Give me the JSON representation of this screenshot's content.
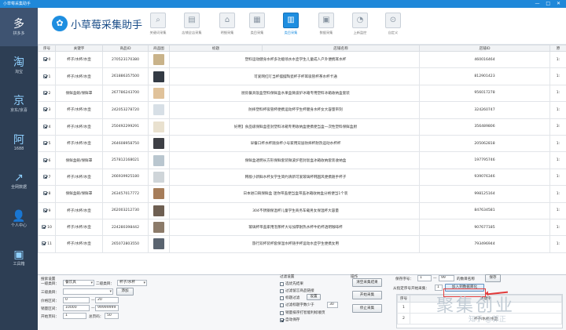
{
  "titlebar": {
    "title": "小草莓采集助手",
    "controls": "—  □  ✕"
  },
  "sidebar": {
    "items": [
      {
        "label": "拼多多",
        "icon": "pdd-icon",
        "glyph": "多"
      },
      {
        "label": "淘宝",
        "icon": "taobao-icon",
        "glyph": "淘"
      },
      {
        "label": "京东/京喜",
        "icon": "jd-icon",
        "glyph": "京"
      },
      {
        "label": "1688",
        "icon": "alibaba-icon",
        "glyph": "阿"
      },
      {
        "label": "全网数据",
        "icon": "chart-icon",
        "glyph": "↗"
      },
      {
        "label": "个人中心",
        "icon": "user-icon",
        "glyph": "👤"
      },
      {
        "label": "工具箱",
        "icon": "toolbox-icon",
        "glyph": "▣"
      }
    ]
  },
  "header": {
    "app_name": "小草莓采集助手",
    "logo_glyph": "✿"
  },
  "toolbar": {
    "tools": [
      {
        "label": "关键词采集",
        "glyph": "⌕",
        "active": false
      },
      {
        "label": "店铺全店采集",
        "glyph": "▤",
        "active": false
      },
      {
        "label": "明细采集",
        "glyph": "⌂",
        "active": false
      },
      {
        "label": "类目采集",
        "glyph": "▦",
        "active": false
      },
      {
        "label": "类目采集",
        "glyph": "▥",
        "active": true
      },
      {
        "label": "数据采集",
        "glyph": "▣",
        "active": false
      },
      {
        "label": "上新监控",
        "glyph": "◔",
        "active": false
      },
      {
        "label": "自定义",
        "glyph": "⊙",
        "active": false
      }
    ]
  },
  "table": {
    "headers": [
      "序号",
      "关键字",
      "商品ID",
      "商品图",
      "标题",
      "店铺名称",
      "店铺ID",
      "原"
    ],
    "rows": [
      {
        "seq": "0",
        "kw": "杯子/水杯/水壶",
        "id": "270523170380",
        "title": "塑料运动健身水杯多功能喷水水壶学生儿童成人户外便携耳水杯",
        "shop": "",
        "shopid": "460016464",
        "extra": "1:",
        "thumb": "#c9b38a"
      },
      {
        "seq": "1",
        "kw": "杯子/水杯/水壶",
        "id": "261886357500",
        "title": "可爱网红叮当杯摆摆陶瓷杯子杯耳吸管杯茶水杯卡通",
        "shop": "",
        "shopid": "812901423",
        "extra": "1:",
        "thumb": "#333a44"
      },
      {
        "seq": "2",
        "kw": "保鲜盒碗/保鲜罩",
        "id": "267786243700",
        "title": "厨房餐具饭盒塑料保鲜盒水果盒微波炉冰箱专用塑料冰箱收纳盒套装",
        "shop": "",
        "shopid": "956017278",
        "extra": "1:",
        "thumb": "#e0c29a"
      },
      {
        "seq": "3",
        "kw": "杯子/水杯/水壶",
        "id": "242053278720",
        "title": "防摔塑料杯吸管杯便携运动杯学生杯健身水杯女大容量带刻",
        "shop": "",
        "shopid": "324260747",
        "extra": "1:",
        "thumb": "#d7dfe6"
      },
      {
        "seq": "4",
        "kw": "杯子/水杯/水壶",
        "id": "250492299291",
        "title": "好用】食品级保鲜盒密封塑料冰箱专用收纳盒便携便当盒一次性塑料保鲜盒厨",
        "shop": "",
        "shopid": "356489806",
        "extra": "3:",
        "thumb": "#e9e1cf"
      },
      {
        "seq": "5",
        "kw": "杯子/水杯/水壶",
        "id": "264608958750",
        "title": "早餐口杯水杯随身杯小号家用双层防摔杯耐热运动水杯杯",
        "shop": "",
        "shopid": "205062818",
        "extra": "1:",
        "thumb": "#3d3f45"
      },
      {
        "seq": "6",
        "kw": "保鲜盒碗/保鲜罩",
        "id": "257812168021",
        "title": "保鲜盒透明长方形保鲜套装微波炉密封饭盒冰箱收纳套装收纳盒",
        "shop": "",
        "shopid": "197795746",
        "extra": "1:",
        "thumb": "#b9c6cf"
      },
      {
        "seq": "7",
        "kw": "杯子/水杯/水壶",
        "id": "266939925180",
        "title": "韩版小新鲜水杯女学生简约清新可爱玻璃杯韩国风便携随手杯子",
        "shop": "",
        "shopid": "939076346",
        "extra": "1:",
        "thumb": "#cfd5d9"
      },
      {
        "seq": "8",
        "kw": "保鲜盒碗/保鲜罩",
        "id": "263457017772",
        "title": "日本进口碗保鲜盒 迷你带盖便当盒带盖冰箱收纳盒分格便当1个装",
        "shop": "",
        "shopid": "998125164",
        "extra": "1:",
        "thumb": "#a67d5a"
      },
      {
        "seq": "9",
        "kw": "杯子/水杯/水壶",
        "id": "262003212730",
        "title": "304不锈钢保温杯儿童学生商务车载男女保温杯大容量",
        "shop": "",
        "shopid": "847634581",
        "extra": "1:",
        "thumb": "#6e5f52"
      },
      {
        "seq": "10",
        "kw": "杯子/水杯/水壶",
        "id": "224280398442",
        "title": "玻璃杯带盖家用泡茶杯大号加厚耐热水杯牛奶杯透明咖啡杯",
        "shop": "",
        "shopid": "907677185",
        "extra": "1:",
        "thumb": "#8c7b6a"
      },
      {
        "seq": "11",
        "kw": "杯子/水杯/水壶",
        "id": "265072803550",
        "title": "旅行双杯装杯套保温水杯随手杯运动水壶学生便携女用",
        "shop": "",
        "shopid": "793496944",
        "extra": "1:",
        "thumb": "#5a6470"
      }
    ]
  },
  "search": {
    "title": "搜索设置",
    "l1": "一级类目：",
    "v1": "餐饮具",
    "l2": "二级类目：",
    "v2": "杯子/水杯",
    "l3": "三级类目：",
    "add": "添加",
    "price_l": "价格区间：",
    "p_from": "0",
    "p_to": "20",
    "sales_l": "销量区间：",
    "s_from": "10000",
    "s_to": "99999999",
    "page_l": "开始页码：",
    "page": "1",
    "per_l": "总页码：",
    "per": "50",
    "dash": "—"
  },
  "filter": {
    "title": "过滤设置",
    "items": [
      {
        "label": "选优先结果",
        "on": false
      },
      {
        "label": "过滤留言商品链接",
        "on": false
      },
      {
        "label": "标题过滤",
        "on": false,
        "btn": "设置"
      },
      {
        "label": "过滤标题字数少于",
        "on": false,
        "num": "30"
      },
      {
        "label": "销量排序打智能利标顺页",
        "on": false
      },
      {
        "label": "自动保存",
        "on": true
      }
    ]
  },
  "ops": {
    "title": "操作",
    "buttons": [
      "清空采集结果",
      "开始采集",
      "停止采集"
    ]
  },
  "save": {
    "l1": "保存序号：",
    "from": "1",
    "to": "99",
    "l2": "的数目名称",
    "btn": "保存",
    "l3": "从指定序号开始采集：",
    "start": "1",
    "btn2": "加入到数据库化"
  },
  "mini": {
    "headers": [
      "序号",
      "关键字"
    ],
    "rows": [
      {
        "seq": "1",
        "kw": ""
      },
      {
        "seq": "2",
        "kw": "杯子/水杯/水壶"
      }
    ]
  },
  "watermark": {
    "big": "聚集创业",
    "small": "知乎 @郭正"
  }
}
